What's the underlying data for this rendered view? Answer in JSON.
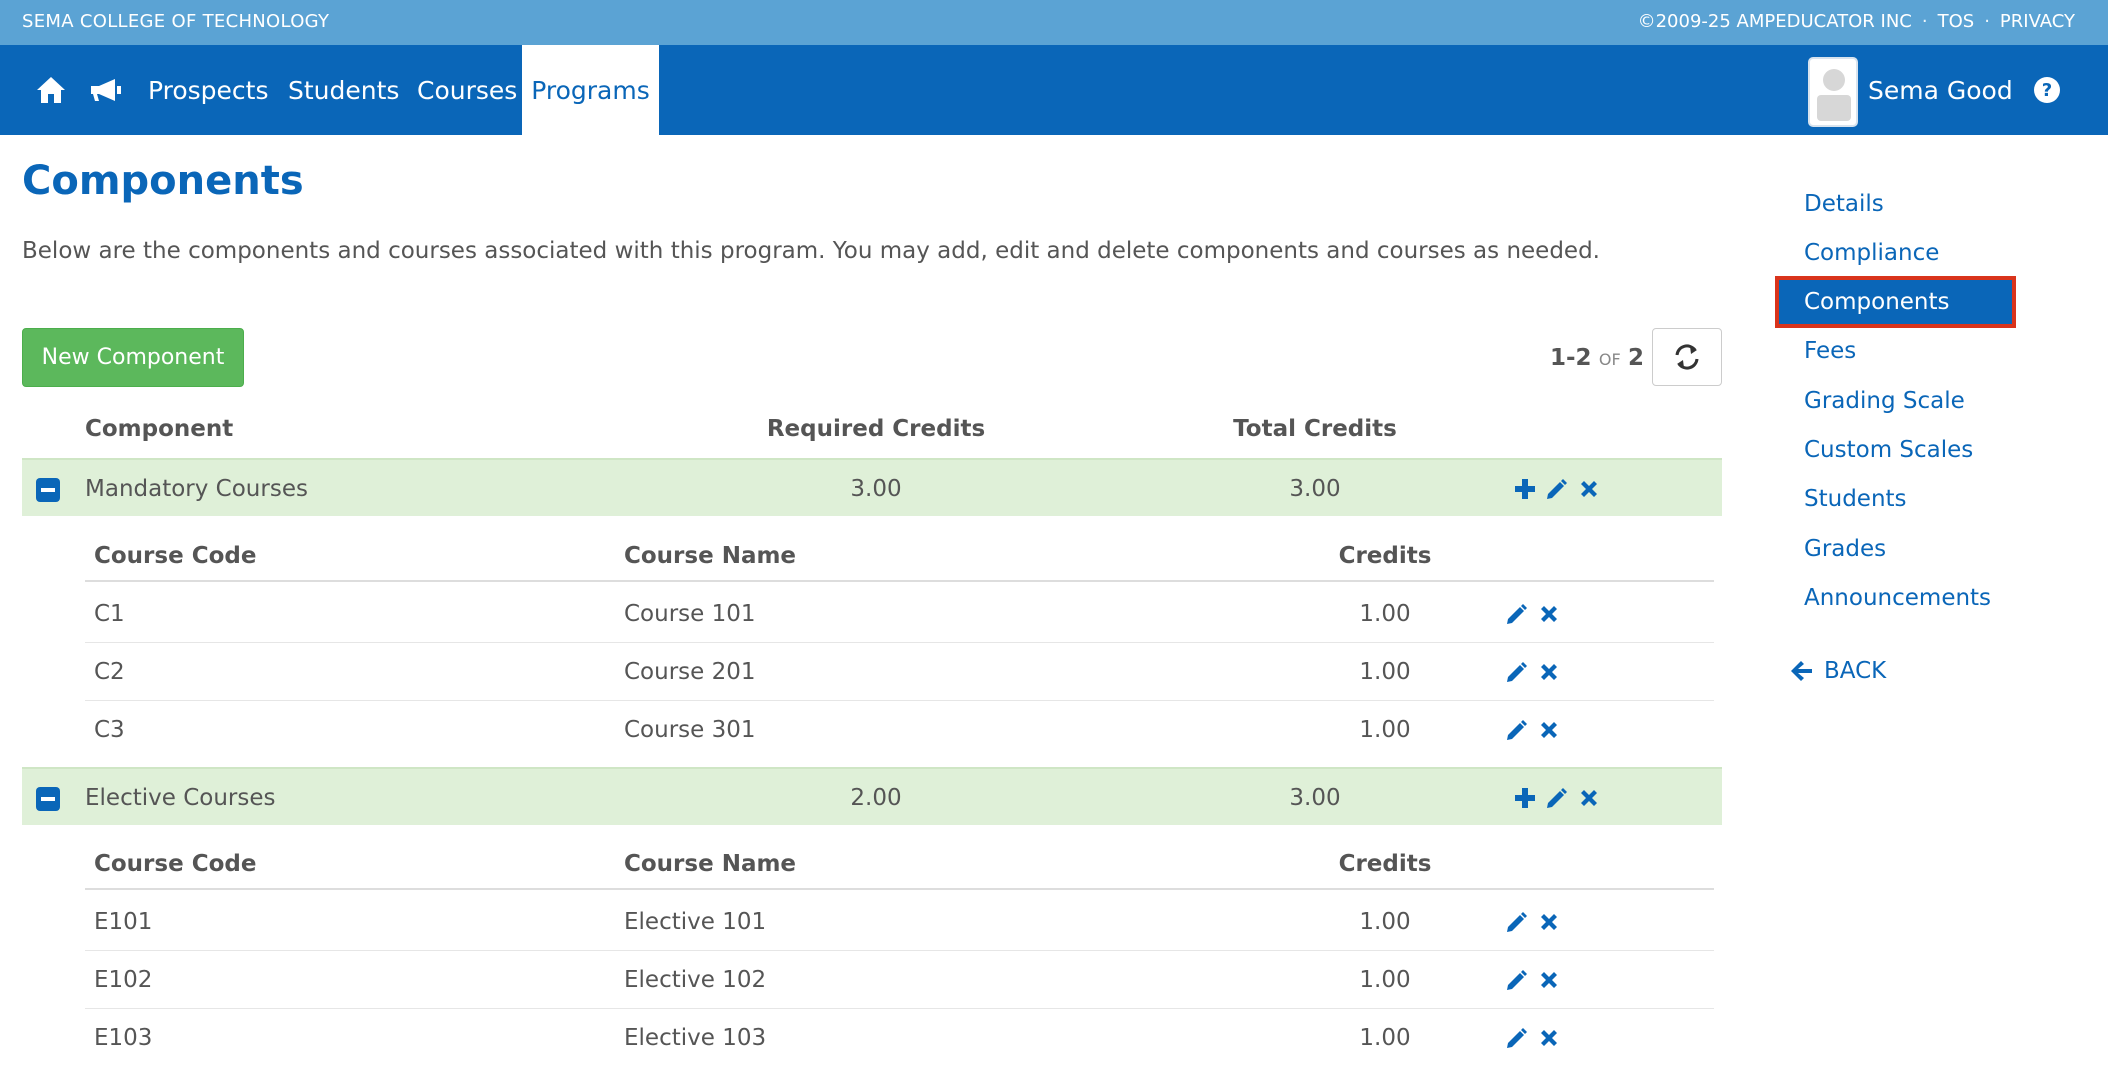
{
  "top": {
    "school": "SEMA COLLEGE OF TECHNOLOGY",
    "copyright": "©2009-25 AMPEDUCATOR INC",
    "sep": "·",
    "tos": "TOS",
    "privacy": "PRIVACY"
  },
  "nav": {
    "prospects": "Prospects",
    "students": "Students",
    "courses": "Courses",
    "programs": "Programs",
    "user": "Sema Good"
  },
  "main": {
    "title": "Components",
    "description": "Below are the components and courses associated with this program. You may add, edit and delete components and courses as needed.",
    "new_button": "New Component",
    "pager": {
      "range": "1-2",
      "of": "OF",
      "total": "2"
    },
    "headers": {
      "component": "Component",
      "required": "Required Credits",
      "total": "Total Credits"
    },
    "sub_headers": {
      "code": "Course Code",
      "name": "Course Name",
      "credits": "Credits"
    },
    "components": [
      {
        "name": "Mandatory Courses",
        "required": "3.00",
        "total": "3.00",
        "courses": [
          {
            "code": "C1",
            "name": "Course 101",
            "credits": "1.00"
          },
          {
            "code": "C2",
            "name": "Course 201",
            "credits": "1.00"
          },
          {
            "code": "C3",
            "name": "Course 301",
            "credits": "1.00"
          }
        ]
      },
      {
        "name": "Elective Courses",
        "required": "2.00",
        "total": "3.00",
        "courses": [
          {
            "code": "E101",
            "name": "Elective 101",
            "credits": "1.00"
          },
          {
            "code": "E102",
            "name": "Elective 102",
            "credits": "1.00"
          },
          {
            "code": "E103",
            "name": "Elective 103",
            "credits": "1.00"
          }
        ]
      }
    ]
  },
  "side": {
    "items": [
      "Details",
      "Compliance",
      "Components",
      "Fees",
      "Grading Scale",
      "Custom Scales",
      "Students",
      "Grades",
      "Announcements"
    ],
    "back": "BACK"
  },
  "colors": {
    "brand": "#0a66b8",
    "strip": "#5ba3d4",
    "success": "#5cb85c",
    "row_highlight": "#dff0d8",
    "selection_outline": "#d9341c"
  },
  "icons": [
    "home-icon",
    "megaphone-icon",
    "help-icon",
    "refresh-icon",
    "plus-icon",
    "pencil-icon",
    "close-icon",
    "arrow-left-icon",
    "minus-square-icon"
  ]
}
